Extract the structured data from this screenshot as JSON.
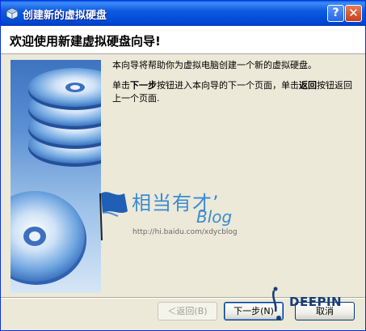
{
  "window": {
    "title": "创建新的虚拟硬盘"
  },
  "header": {
    "title": "欢迎使用新建虚拟硬盘向导!"
  },
  "content": {
    "paragraph1": "本向导将帮助你为虚拟电脑创建一个新的虚拟硬盘。",
    "p2_part1": "单击",
    "p2_bold1": "下一步",
    "p2_part2": "按钮进入本向导的下一个页面，单击",
    "p2_bold2": "返回",
    "p2_part3": "按钮返回上一个页面."
  },
  "watermark": {
    "text": "相当有才’",
    "blog": "Blog",
    "url": "http://hi.baidu.com/xdycblog",
    "logo": "DEEPIN"
  },
  "buttons": {
    "back": "＜返回(B)",
    "next": "下一步(N)",
    "cancel": "取消"
  },
  "colors": {
    "titlebar": "#0054E3",
    "dialog_bg": "#ECE9D8",
    "watermark_blue": "#3A8BD3"
  }
}
